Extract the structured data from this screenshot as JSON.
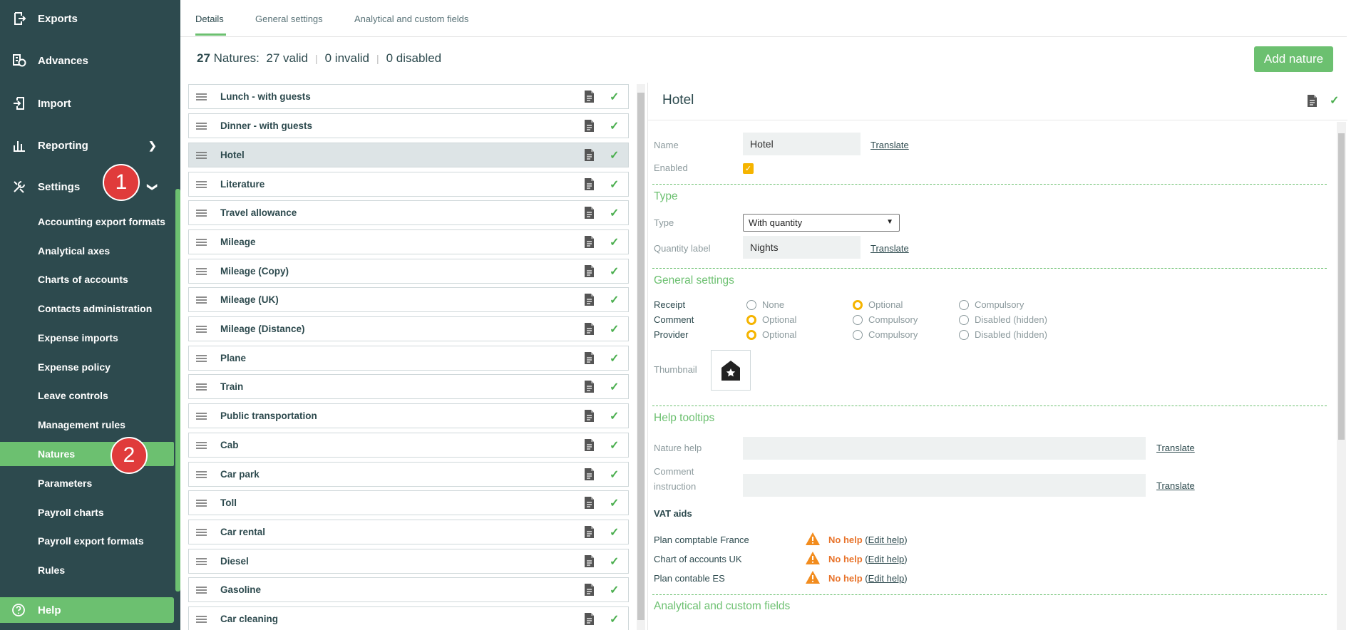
{
  "sidebar": {
    "main_items": [
      {
        "label": "Exports",
        "icon": "export-icon"
      },
      {
        "label": "Advances",
        "icon": "advances-icon"
      },
      {
        "label": "Import",
        "icon": "import-icon"
      },
      {
        "label": "Reporting",
        "icon": "bar-chart-icon"
      },
      {
        "label": "Settings",
        "icon": "settings-tools-icon"
      }
    ],
    "sub_items": [
      "Accounting export formats",
      "Analytical axes",
      "Charts of accounts",
      "Contacts administration",
      "Expense imports",
      "Expense policy",
      "Leave controls",
      "Management rules",
      "Natures",
      "Parameters",
      "Payroll charts",
      "Payroll export formats",
      "Rules"
    ],
    "active_sub": "Natures",
    "help_label": "Help",
    "badges": [
      "1",
      "2"
    ]
  },
  "tabs": [
    "Details",
    "General settings",
    "Analytical and custom fields"
  ],
  "summary": {
    "count": "27",
    "count_label": "Natures:",
    "valid": "27 valid",
    "invalid": "0 invalid",
    "disabled": "0 disabled"
  },
  "add_nature_label": "Add nature",
  "natures": [
    "Lunch - with guests",
    "Dinner - with guests",
    "Hotel",
    "Literature",
    "Travel allowance",
    "Mileage",
    "Mileage (Copy)",
    "Mileage (UK)",
    "Mileage (Distance)",
    "Plane",
    "Train",
    "Public transportation",
    "Cab",
    "Car park",
    "Toll",
    "Car rental",
    "Diesel",
    "Gasoline",
    "Car cleaning"
  ],
  "selected_nature": "Hotel",
  "detail": {
    "title": "Hotel",
    "name_label": "Name",
    "name_value": "Hotel",
    "translate": "Translate",
    "enabled_label": "Enabled",
    "type_section": "Type",
    "type_label": "Type",
    "type_value": "With quantity",
    "quantity_label_label": "Quantity label",
    "quantity_label_value": "Nights",
    "general_section": "General settings",
    "receipt_label": "Receipt",
    "comment_label": "Comment",
    "provider_label": "Provider",
    "opt_none": "None",
    "opt_optional": "Optional",
    "opt_compulsory": "Compulsory",
    "opt_disabled": "Disabled (hidden)",
    "thumbnail_label": "Thumbnail",
    "help_section": "Help tooltips",
    "nature_help_label": "Nature help",
    "comment_instruction_label_1": "Comment",
    "comment_instruction_label_2": "instruction",
    "vat_title": "VAT aids",
    "vat_rows": [
      {
        "name": "Plan comptable France",
        "status": "No help",
        "edit": "Edit help"
      },
      {
        "name": "Chart of accounts UK",
        "status": "No help",
        "edit": "Edit help"
      },
      {
        "name": "Plan contable ES",
        "status": "No help",
        "edit": "Edit help"
      }
    ],
    "analytical_section": "Analytical and custom fields"
  }
}
